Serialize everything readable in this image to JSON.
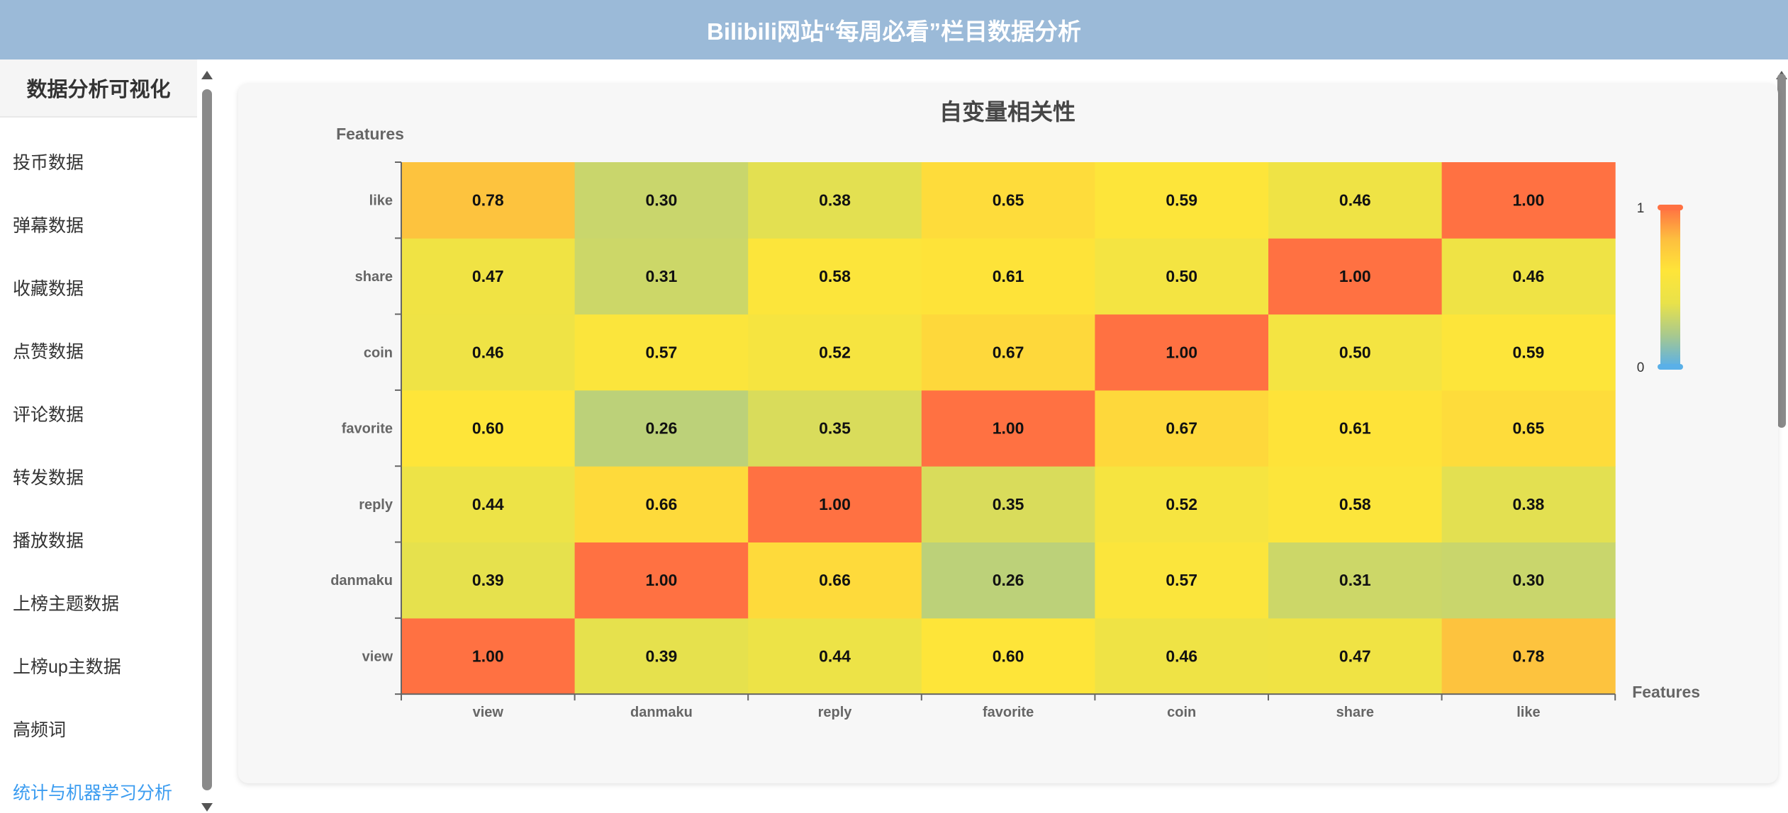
{
  "header": {
    "title": "Bilibili网站“每周必看”栏目数据分析"
  },
  "sidebar": {
    "title": "数据分析可视化",
    "items": [
      {
        "label": "投币数据"
      },
      {
        "label": "弹幕数据"
      },
      {
        "label": "收藏数据"
      },
      {
        "label": "点赞数据"
      },
      {
        "label": "评论数据"
      },
      {
        "label": "转发数据"
      },
      {
        "label": "播放数据"
      },
      {
        "label": "上榜主题数据"
      },
      {
        "label": "上榜up主数据"
      },
      {
        "label": "高频词"
      },
      {
        "label": "统计与机器学习分析",
        "active": true
      }
    ]
  },
  "colors": {
    "header_bg": "#9bbad8",
    "active_item": "#3b9cf0",
    "scale": [
      "#5ab0e8",
      "#a9c98d",
      "#e9e24a",
      "#fee539",
      "#fdbf3f",
      "#ff7142"
    ]
  },
  "chart_data": {
    "type": "heatmap",
    "title": "自变量相关性",
    "xlabel": "Features",
    "ylabel": "Features",
    "x": [
      "view",
      "danmaku",
      "reply",
      "favorite",
      "coin",
      "share",
      "like"
    ],
    "y": [
      "view",
      "danmaku",
      "reply",
      "favorite",
      "coin",
      "share",
      "like"
    ],
    "values": [
      [
        1.0,
        0.39,
        0.44,
        0.6,
        0.46,
        0.47,
        0.78
      ],
      [
        0.39,
        1.0,
        0.66,
        0.26,
        0.57,
        0.31,
        0.3
      ],
      [
        0.44,
        0.66,
        1.0,
        0.35,
        0.52,
        0.58,
        0.38
      ],
      [
        0.6,
        0.26,
        0.35,
        1.0,
        0.67,
        0.61,
        0.65
      ],
      [
        0.46,
        0.57,
        0.52,
        0.67,
        1.0,
        0.5,
        0.59
      ],
      [
        0.47,
        0.31,
        0.58,
        0.61,
        0.5,
        1.0,
        0.46
      ],
      [
        0.78,
        0.3,
        0.38,
        0.65,
        0.59,
        0.46,
        1.0
      ]
    ],
    "visual_map": {
      "min": 0,
      "max": 1,
      "min_label": "0",
      "max_label": "1"
    },
    "grid": false,
    "legend": "right"
  }
}
